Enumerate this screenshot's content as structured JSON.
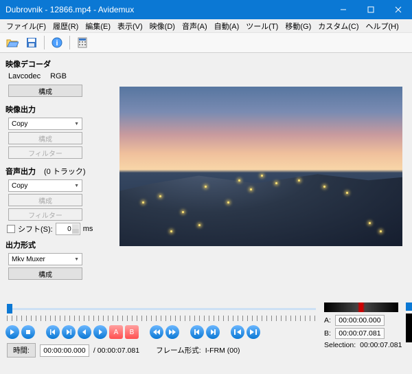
{
  "title": "Dubrovnik - 12866.mp4 - Avidemux",
  "menu": [
    "ファイル(F)",
    "履歴(R)",
    "編集(E)",
    "表示(V)",
    "映像(D)",
    "音声(A)",
    "自動(A)",
    "ツール(T)",
    "移動(G)",
    "カスタム(C)",
    "ヘルプ(H)"
  ],
  "decoder": {
    "heading": "映像デコーダ",
    "codec": "Lavcodec",
    "color": "RGB",
    "config": "構成"
  },
  "videoOut": {
    "heading": "映像出力",
    "value": "Copy",
    "config": "構成",
    "filter": "フィルター"
  },
  "audioOut": {
    "heading": "音声出力",
    "tracks": "(0 トラック)",
    "value": "Copy",
    "config": "構成",
    "filter": "フィルター",
    "shiftLabel": "シフト(S):",
    "shiftValue": "0",
    "ms": "ms"
  },
  "outFmt": {
    "heading": "出力形式",
    "value": "Mkv Muxer",
    "config": "構成"
  },
  "ab": {
    "aLabel": "A:",
    "aVal": "00:00:00.000",
    "bLabel": "B:",
    "bVal": "00:00:07.081",
    "selLabel": "Selection:",
    "selVal": "00:00:07.081"
  },
  "status": {
    "timeBtn": "時間:",
    "time": "00:00:00.000",
    "totalPrefix": "/ ",
    "total": "00:00:07.081",
    "frameTypeLabel": "フレーム形式:",
    "frameType": "I-FRM (00)"
  }
}
